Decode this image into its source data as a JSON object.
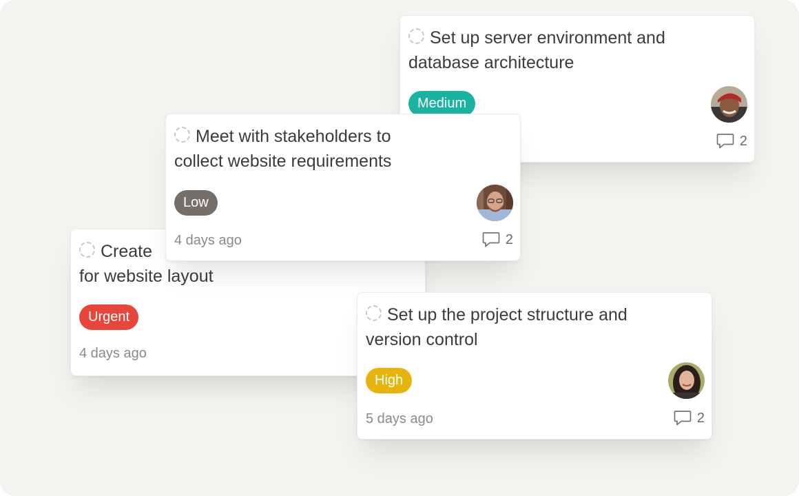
{
  "colors": {
    "background": "#f4f3ef",
    "priority_low": "#766f69",
    "priority_medium": "#1ab39f",
    "priority_high": "#e6b40c",
    "priority_urgent": "#e8453b"
  },
  "tasks": [
    {
      "title": "Set up server environment and database architecture",
      "priority": "Medium",
      "assignee_avatar": "avatar-man-red-bandana",
      "timestamp": "",
      "comment_count": "2"
    },
    {
      "title": "Meet with stakeholders to collect website requirements",
      "priority": "Low",
      "assignee_avatar": "avatar-man-glasses",
      "timestamp": "4 days ago",
      "comment_count": "2"
    },
    {
      "title": "Create",
      "title_line2": "for website layout",
      "priority": "Urgent",
      "assignee_avatar": "",
      "timestamp": "4 days ago",
      "comment_count": ""
    },
    {
      "title": "Set up the project structure and version control",
      "priority": "High",
      "assignee_avatar": "avatar-woman-dark-hair",
      "timestamp": "5 days ago",
      "comment_count": "2"
    }
  ],
  "icons": {
    "status": "dashed-circle-icon",
    "comments": "speech-bubble-icon"
  }
}
